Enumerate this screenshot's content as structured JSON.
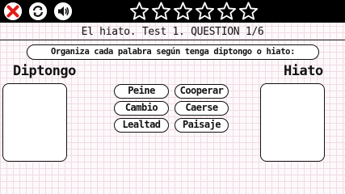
{
  "top_bar": {
    "controls": [
      {
        "icon": "close-icon"
      },
      {
        "icon": "refresh-icon"
      },
      {
        "icon": "speaker-icon"
      }
    ],
    "stars_total": 6,
    "stars_filled": 0
  },
  "title": "El hiato. Test 1. QUESTION 1/6",
  "instructions": "Organiza cada palabra según tenga diptongo o hiato:",
  "columns": {
    "left": "Diptongo",
    "right": "Hiato"
  },
  "words": [
    "Peine",
    "Cooperar",
    "Cambio",
    "Caerse",
    "Lealtad",
    "Paisaje"
  ],
  "colors": {
    "close": "#e11d17",
    "bar": "#000000",
    "grid": "#f1dbe6"
  }
}
